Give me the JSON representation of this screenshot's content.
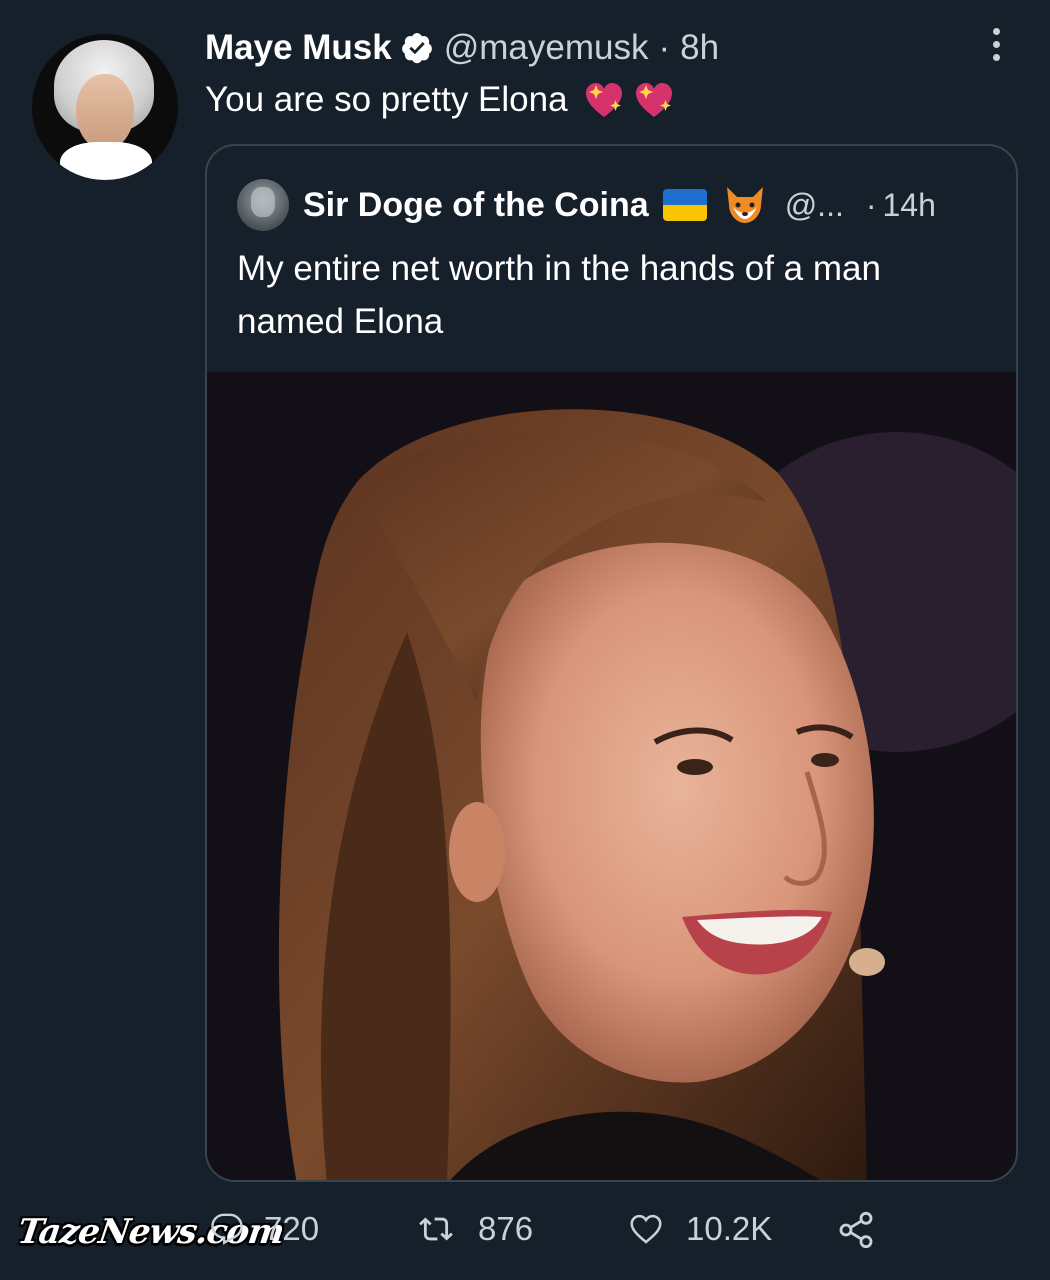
{
  "tweet": {
    "author_name": "Maye Musk",
    "handle": "@mayemusk",
    "separator": "·",
    "time": "8h",
    "text": "You are so pretty Elona",
    "text_emoji": [
      "sparkling-heart-icon",
      "sparkling-heart-icon"
    ]
  },
  "quoted": {
    "author_name": "Sir Doge of the Coina",
    "flag_emoji": "ukraine-flag-icon",
    "fox_emoji": "fox-icon",
    "handle": "@...",
    "separator": "·",
    "time": "14h",
    "text": "My entire net worth in the hands of a man named Elona"
  },
  "actions": {
    "replies": "720",
    "retweets": "876",
    "likes": "10.2K"
  },
  "watermark": "TazeNews.com",
  "colors": {
    "background": "#15202b",
    "border": "#38444d",
    "text_primary": "#ffffff",
    "text_secondary": "#c9d1d9",
    "verified_badge": "#ffffff"
  }
}
